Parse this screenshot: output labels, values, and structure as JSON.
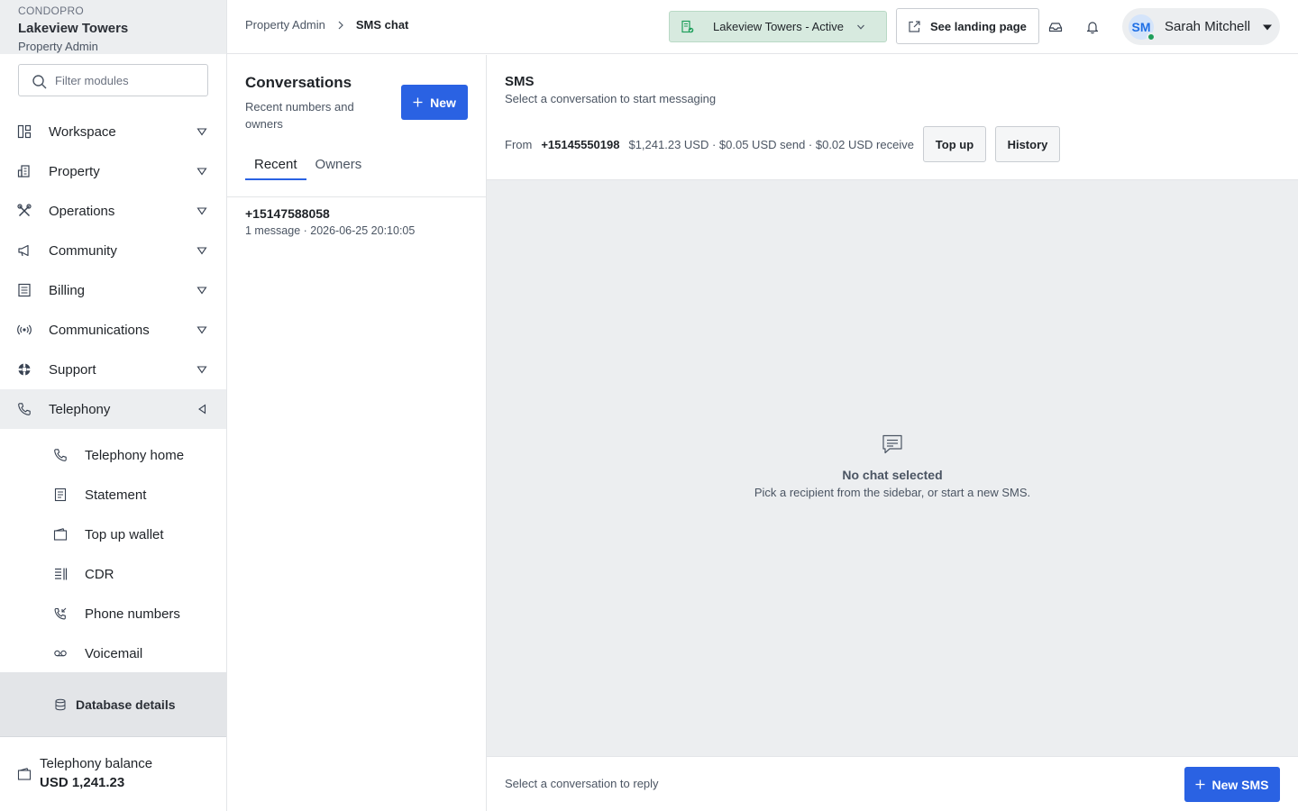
{
  "brand": {
    "org": "CONDOPRO",
    "property": "Lakeview Towers",
    "role": "Property Admin"
  },
  "filter": {
    "placeholder": "Filter modules"
  },
  "nav": {
    "items": [
      {
        "label": "Workspace",
        "icon": "workspace-icon",
        "caret": "down"
      },
      {
        "label": "Property",
        "icon": "building-icon",
        "caret": "down"
      },
      {
        "label": "Operations",
        "icon": "tools-icon",
        "caret": "down"
      },
      {
        "label": "Community",
        "icon": "megaphone-icon",
        "caret": "down"
      },
      {
        "label": "Billing",
        "icon": "billing-icon",
        "caret": "down"
      },
      {
        "label": "Communications",
        "icon": "broadcast-icon",
        "caret": "down"
      },
      {
        "label": "Support",
        "icon": "lifebuoy-icon",
        "caret": "down"
      },
      {
        "label": "Telephony",
        "icon": "phone-icon",
        "caret": "left",
        "active": true
      }
    ],
    "subitems": [
      {
        "label": "Telephony home",
        "icon": "phone-icon"
      },
      {
        "label": "Statement",
        "icon": "statement-icon"
      },
      {
        "label": "Top up wallet",
        "icon": "wallet-icon"
      },
      {
        "label": "CDR",
        "icon": "cdr-icon"
      },
      {
        "label": "Phone numbers",
        "icon": "phone-incoming-icon"
      },
      {
        "label": "Voicemail",
        "icon": "voicemail-icon"
      }
    ],
    "database": "Database details"
  },
  "balance": {
    "label": "Telephony balance",
    "value": "USD 1,241.23"
  },
  "header": {
    "breadcrumb": [
      "Property Admin",
      "SMS chat"
    ],
    "property_select": "Lakeview Towers - Active",
    "landing": "See landing page",
    "user": {
      "initials": "SM",
      "name": "Sarah Mitchell",
      "status_color": "#1e9e5a"
    }
  },
  "conversations": {
    "title": "Conversations",
    "subtitle": "Recent numbers and owners",
    "new_label": "New",
    "tabs": [
      "Recent",
      "Owners"
    ],
    "active_tab": "Recent",
    "items": [
      {
        "number": "+15147588058",
        "meta": "1 message · 2026-06-25 20:10:05"
      }
    ]
  },
  "sms": {
    "title": "SMS",
    "subtitle": "Select a conversation to start messaging",
    "from_label": "From",
    "from_number": "+15145550198",
    "rates": "$1,241.23 USD · $0.05 USD send · $0.02 USD receive",
    "topup_label": "Top up",
    "history_label": "History",
    "empty_title": "No chat selected",
    "empty_desc": "Pick a recipient from the sidebar, or start a new SMS.",
    "reply_placeholder": "Select a conversation to reply",
    "new_sms_label": "New SMS"
  },
  "colors": {
    "accent": "#2a62e3",
    "property_chip": "#d7eadf",
    "online": "#1e9e5a"
  }
}
